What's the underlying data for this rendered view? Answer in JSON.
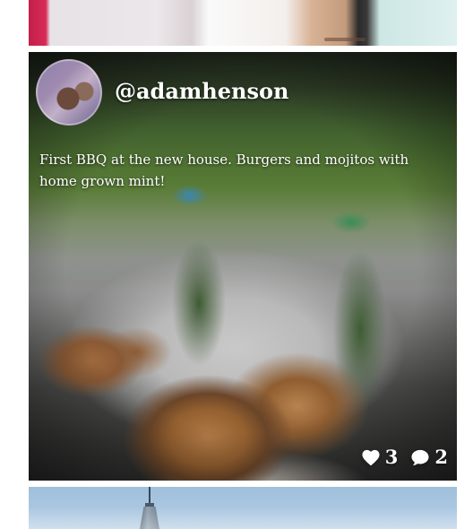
{
  "post": {
    "username": "@adamhenson",
    "caption": "First BBQ at the new house. Burgers and mojitos with home grown mint!",
    "likes": "3",
    "comments": "2",
    "icons": {
      "like": "heart-icon",
      "comment": "speech-bubble-icon"
    }
  },
  "colors": {
    "text": "#ffffff",
    "page_background": "#ffffff"
  }
}
